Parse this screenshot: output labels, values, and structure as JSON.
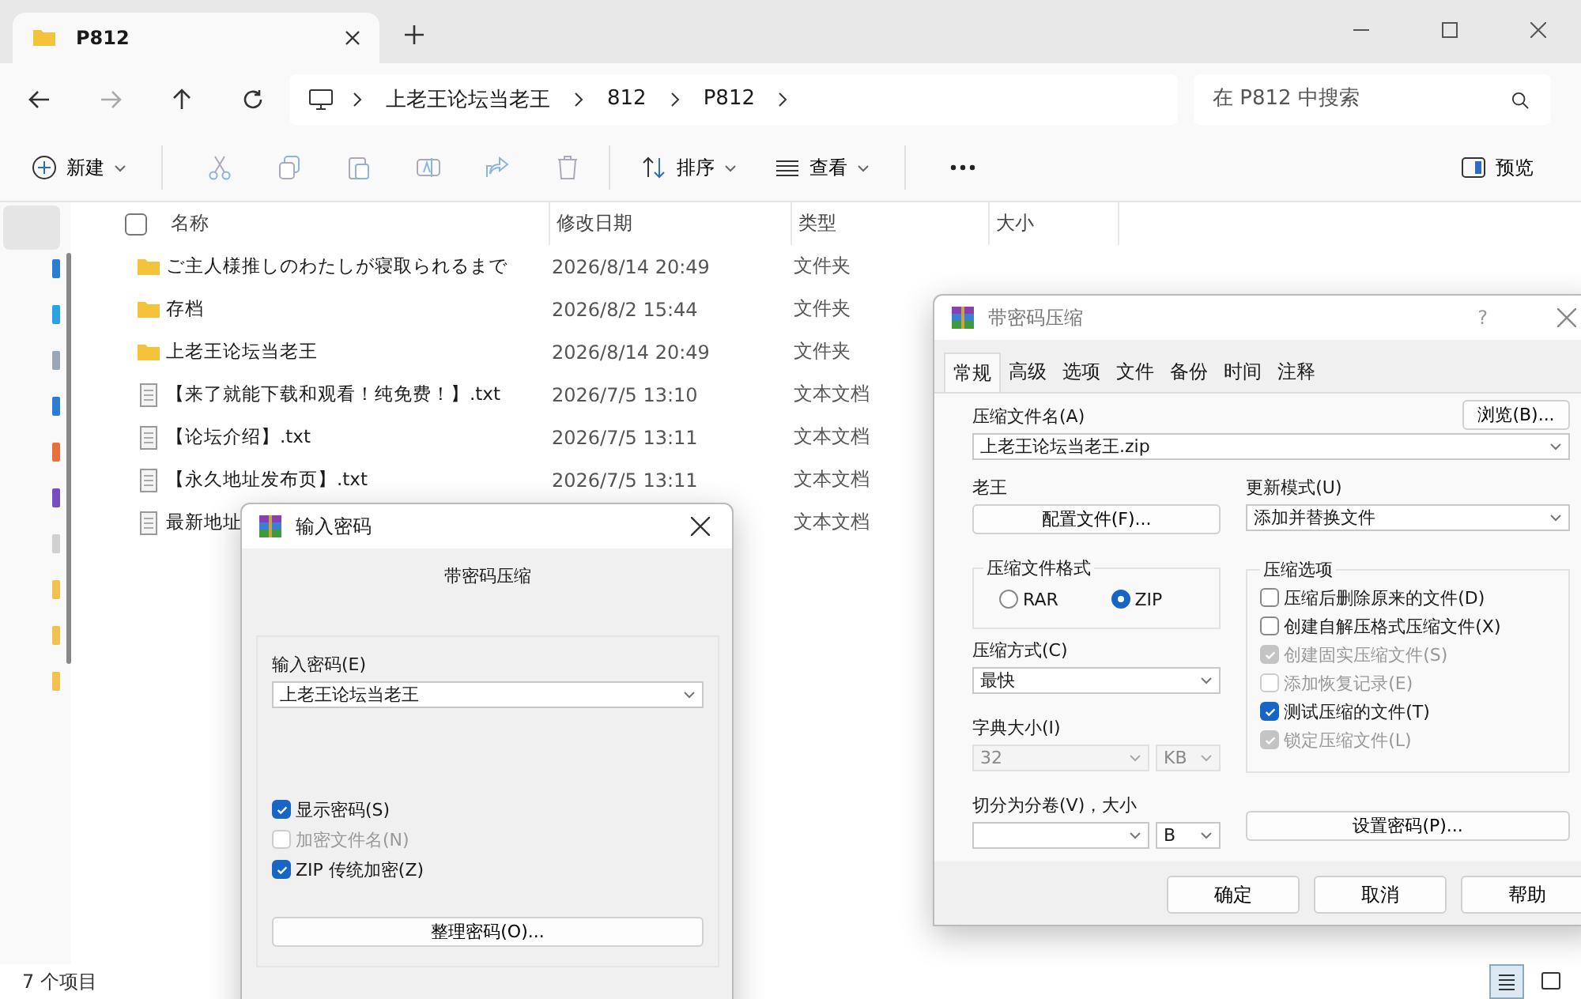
{
  "explorer": {
    "tab": {
      "title": "P812"
    },
    "breadcrumb": [
      "上老王论坛当老王",
      "812",
      "P812"
    ],
    "search": {
      "placeholder": "在 P812 中搜索"
    },
    "toolbar": {
      "new": "新建",
      "sort": "排序",
      "view": "查看",
      "preview": "预览"
    },
    "select_all": {
      "checked": false
    },
    "columns": [
      "名称",
      "修改日期",
      "类型",
      "大小"
    ],
    "rows": [
      {
        "kind": "folder",
        "name": "ご主人様推しのわたしが寝取られるまで",
        "date": "2026/8/14 20:49",
        "type": "文件夹"
      },
      {
        "kind": "folder",
        "name": "存档",
        "date": "2026/8/2 15:44",
        "type": "文件夹"
      },
      {
        "kind": "folder",
        "name": "上老王论坛当老王",
        "date": "2026/8/14 20:49",
        "type": "文件夹"
      },
      {
        "kind": "text",
        "name": "【来了就能下载和观看！纯免费！】.txt",
        "date": "2026/7/5 13:10",
        "type": "文本文档"
      },
      {
        "kind": "text",
        "name": "【论坛介绍】.txt",
        "date": "2026/7/5 13:11",
        "type": "文本文档"
      },
      {
        "kind": "text",
        "name": "【永久地址发布页】.txt",
        "date": "2026/7/5 13:11",
        "type": "文本文档"
      },
      {
        "kind": "text",
        "name": "最新地址",
        "type": "文本文档"
      }
    ],
    "status": "7 个项目"
  },
  "password_dialog": {
    "title": "输入密码",
    "heading": "带密码压缩",
    "label": "输入密码(E)",
    "value": "上老王论坛当老王",
    "checkboxes": [
      {
        "label": "显示密码(S)",
        "checked": true,
        "disabled": false
      },
      {
        "label": "加密文件名(N)",
        "checked": false,
        "disabled": true
      },
      {
        "label": "ZIP 传统加密(Z)",
        "checked": true,
        "disabled": false
      }
    ],
    "button": "整理密码(O)..."
  },
  "archive_dialog": {
    "title": "带密码压缩",
    "help": "?",
    "tabs": [
      {
        "label": "常规",
        "selected": true
      },
      {
        "label": "高级",
        "selected": false
      },
      {
        "label": "选项",
        "selected": false
      },
      {
        "label": "文件",
        "selected": false
      },
      {
        "label": "备份",
        "selected": false
      },
      {
        "label": "时间",
        "selected": false
      },
      {
        "label": "注释",
        "selected": false
      }
    ],
    "filename_label": "压缩文件名(A)",
    "filename": "上老王论坛当老王.zip",
    "browse": "浏览(B)...",
    "profile_label": "老王",
    "profile_button": "配置文件(F)...",
    "update_label": "更新模式(U)",
    "update_value": "添加并替换文件",
    "format_legend": "压缩文件格式",
    "formats": [
      {
        "label": "RAR",
        "selected": false
      },
      {
        "label": "ZIP",
        "selected": true
      }
    ],
    "options_legend": "压缩选项",
    "options": [
      {
        "label": "压缩后删除原来的文件(D)",
        "checked": false,
        "disabled": false
      },
      {
        "label": "创建自解压格式压缩文件(X)",
        "checked": false,
        "disabled": false
      },
      {
        "label": "创建固实压缩文件(S)",
        "checked": true,
        "disabled": true
      },
      {
        "label": "添加恢复记录(E)",
        "checked": false,
        "disabled": true
      },
      {
        "label": "测试压缩的文件(T)",
        "checked": true,
        "disabled": false
      },
      {
        "label": "锁定压缩文件(L)",
        "checked": true,
        "disabled": true
      }
    ],
    "method_label": "压缩方式(C)",
    "method_value": "最快",
    "dict_label": "字典大小(I)",
    "dict_value": "32",
    "dict_unit": "KB",
    "split_label": "切分为分卷(V)，大小",
    "split_unit": "B",
    "set_password": "设置密码(P)...",
    "buttons": [
      "确定",
      "取消",
      "帮助"
    ]
  }
}
